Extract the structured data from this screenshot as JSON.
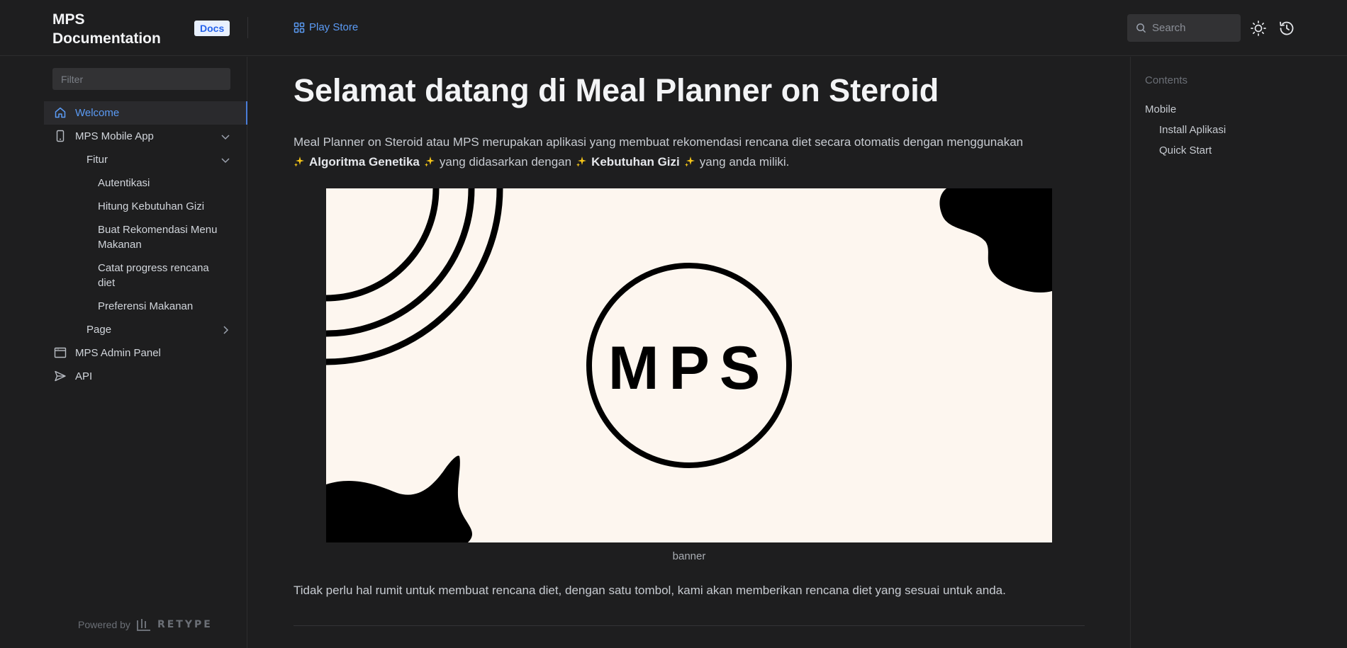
{
  "header": {
    "brand": "MPS Documentation",
    "badge": "Docs",
    "playstore_label": "Play Store",
    "search_placeholder": "Search"
  },
  "sidebar": {
    "filter_placeholder": "Filter",
    "items": [
      {
        "label": "Welcome",
        "icon": "home-icon",
        "active": true
      },
      {
        "label": "MPS Mobile App",
        "icon": "mobile-icon",
        "expanded": true
      },
      {
        "label": "Fitur",
        "expanded": true
      },
      {
        "label": "Autentikasi"
      },
      {
        "label": "Hitung Kebutuhan Gizi"
      },
      {
        "label": "Buat Rekomendasi Menu Makanan"
      },
      {
        "label": "Catat progress rencana diet"
      },
      {
        "label": "Preferensi Makanan"
      },
      {
        "label": "Page",
        "expanded": false
      },
      {
        "label": "MPS Admin Panel",
        "icon": "browser-window-icon"
      },
      {
        "label": "API",
        "icon": "paper-plane-icon"
      }
    ],
    "powered_by": "Powered by",
    "retype": "RETYPE"
  },
  "main": {
    "title": "Selamat datang di Meal Planner on Steroid",
    "intro_text": "Meal Planner on Steroid atau MPS merupakan aplikasi yang membuat rekomendasi rencana diet secara otomatis dengan menggunakan",
    "highlight_1": "Algoritma Genetika",
    "mid_text": "yang didasarkan dengan",
    "highlight_2": "Kebutuhan Gizi",
    "end_text": "yang anda miliki.",
    "banner_logo": "MPS",
    "caption": "banner",
    "outro": "Tidak perlu hal rumit untuk membuat rencana diet, dengan satu tombol, kami akan memberikan rencana diet yang sesuai untuk anda."
  },
  "toc": {
    "title": "Contents",
    "items": [
      "Mobile",
      "Install Aplikasi",
      "Quick Start"
    ]
  },
  "colors": {
    "accent": "#5b9bf5",
    "background": "#1e1e1f",
    "banner_bg": "#fdf6ef"
  }
}
